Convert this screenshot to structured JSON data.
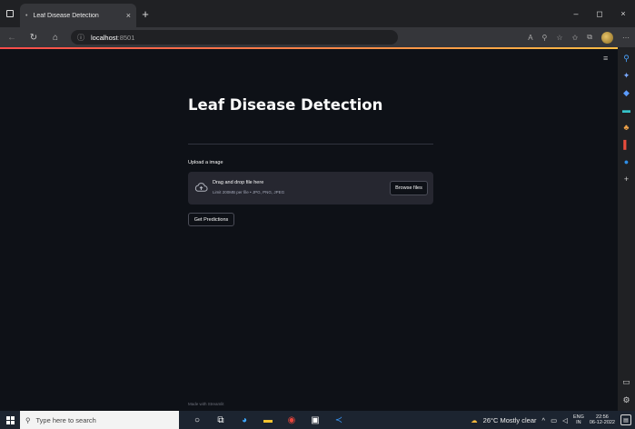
{
  "browser": {
    "tab_title": "Leaf Disease Detection",
    "tab_close": "×",
    "new_tab": "+",
    "window_controls": [
      "–",
      "◻",
      "×"
    ],
    "address": {
      "host": "localhost",
      "port": ":8501"
    }
  },
  "app": {
    "title": "Leaf Disease Detection",
    "uploader_label": "Upload a image",
    "dropzone_main": "Drag and drop file here",
    "dropzone_sub": "Limit 200MB per file • JPG, PNG, JPEG",
    "browse_label": "Browse files",
    "predict_label": "Get Predictions",
    "footer": "Made with Streamlit"
  },
  "taskbar": {
    "search_placeholder": "Type here to search",
    "weather": "26°C  Mostly clear",
    "lang_top": "ENG",
    "lang_bottom": "IN",
    "time": "22:56",
    "date": "06-12-2022"
  },
  "colors": {
    "app_bg": "#0e1117",
    "widget_bg": "#262730",
    "accent_start": "#ff4b4b",
    "accent_end": "#ffbd45"
  },
  "icons": [
    "search-icon",
    "home-icon",
    "refresh-icon",
    "back-icon",
    "info-icon",
    "cloud-upload-icon",
    "windows-start-icon",
    "weather-icon"
  ]
}
